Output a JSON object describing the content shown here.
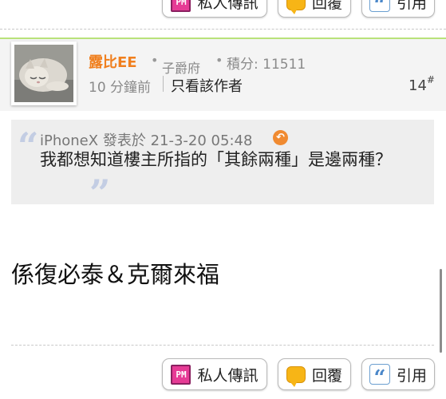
{
  "actions": {
    "pm_label": "私人傳訊",
    "pm_icon_text": "PM",
    "reply_label": "回覆",
    "quote_label": "引用"
  },
  "post": {
    "username": "露比EE",
    "rank": "子爵府",
    "points_label": "積分: 11511",
    "time": "10 分鐘前",
    "author_only_label": "只看該作者",
    "floor": "14",
    "floor_suffix": "#",
    "quote": {
      "author": "iPhoneX",
      "posted_label": "發表於",
      "datetime": "21-3-20 05:48",
      "text": "我都想知道樓主所指的「其餘兩種」是邊兩種？"
    },
    "body": "係復必泰＆克爾來福"
  },
  "colors": {
    "username": "#f07f1e",
    "accent_green": "#b9e27a",
    "quote_bg": "#eeeeee"
  },
  "icons": [
    "pm-icon",
    "reply-bubble-icon",
    "quote-icon",
    "avatar-cat-image",
    "back-arrow-icon"
  ]
}
